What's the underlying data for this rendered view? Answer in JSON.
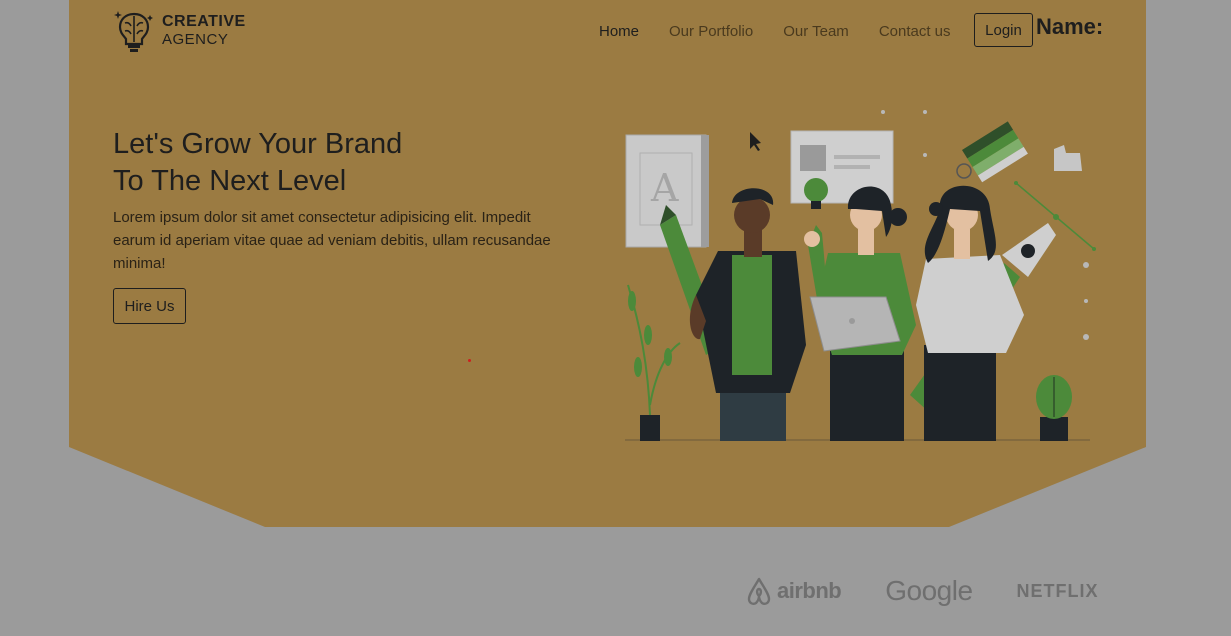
{
  "brand": {
    "line1": "CREATIVE",
    "line2": "AGENCY",
    "icon": "brain-bulb-icon"
  },
  "nav": {
    "items": [
      {
        "label": "Home",
        "active": true
      },
      {
        "label": "Our Portfolio"
      },
      {
        "label": "Our Team"
      },
      {
        "label": "Contact us"
      }
    ],
    "login_label": "Login"
  },
  "name_label": "Name:",
  "hero": {
    "headline_line1": "Let's Grow Your Brand",
    "headline_line2": "To The Next Level",
    "description": "Lorem ipsum dolor sit amet consectetur adipisicing elit. Impedit earum id aperiam vitae quae ad veniam debitis, ullam recusandae minima!",
    "cta_label": "Hire Us"
  },
  "illustration": {
    "icon": "creative-team-illustration"
  },
  "partners": {
    "airbnb": "airbnb",
    "google": "Google",
    "netflix": "NETFLIX"
  },
  "colors": {
    "hero_bg": "#9b7b42",
    "page_bg": "#9b9b9b",
    "text_dark": "#1e1e1e",
    "accent_green": "#4c8a3a"
  }
}
